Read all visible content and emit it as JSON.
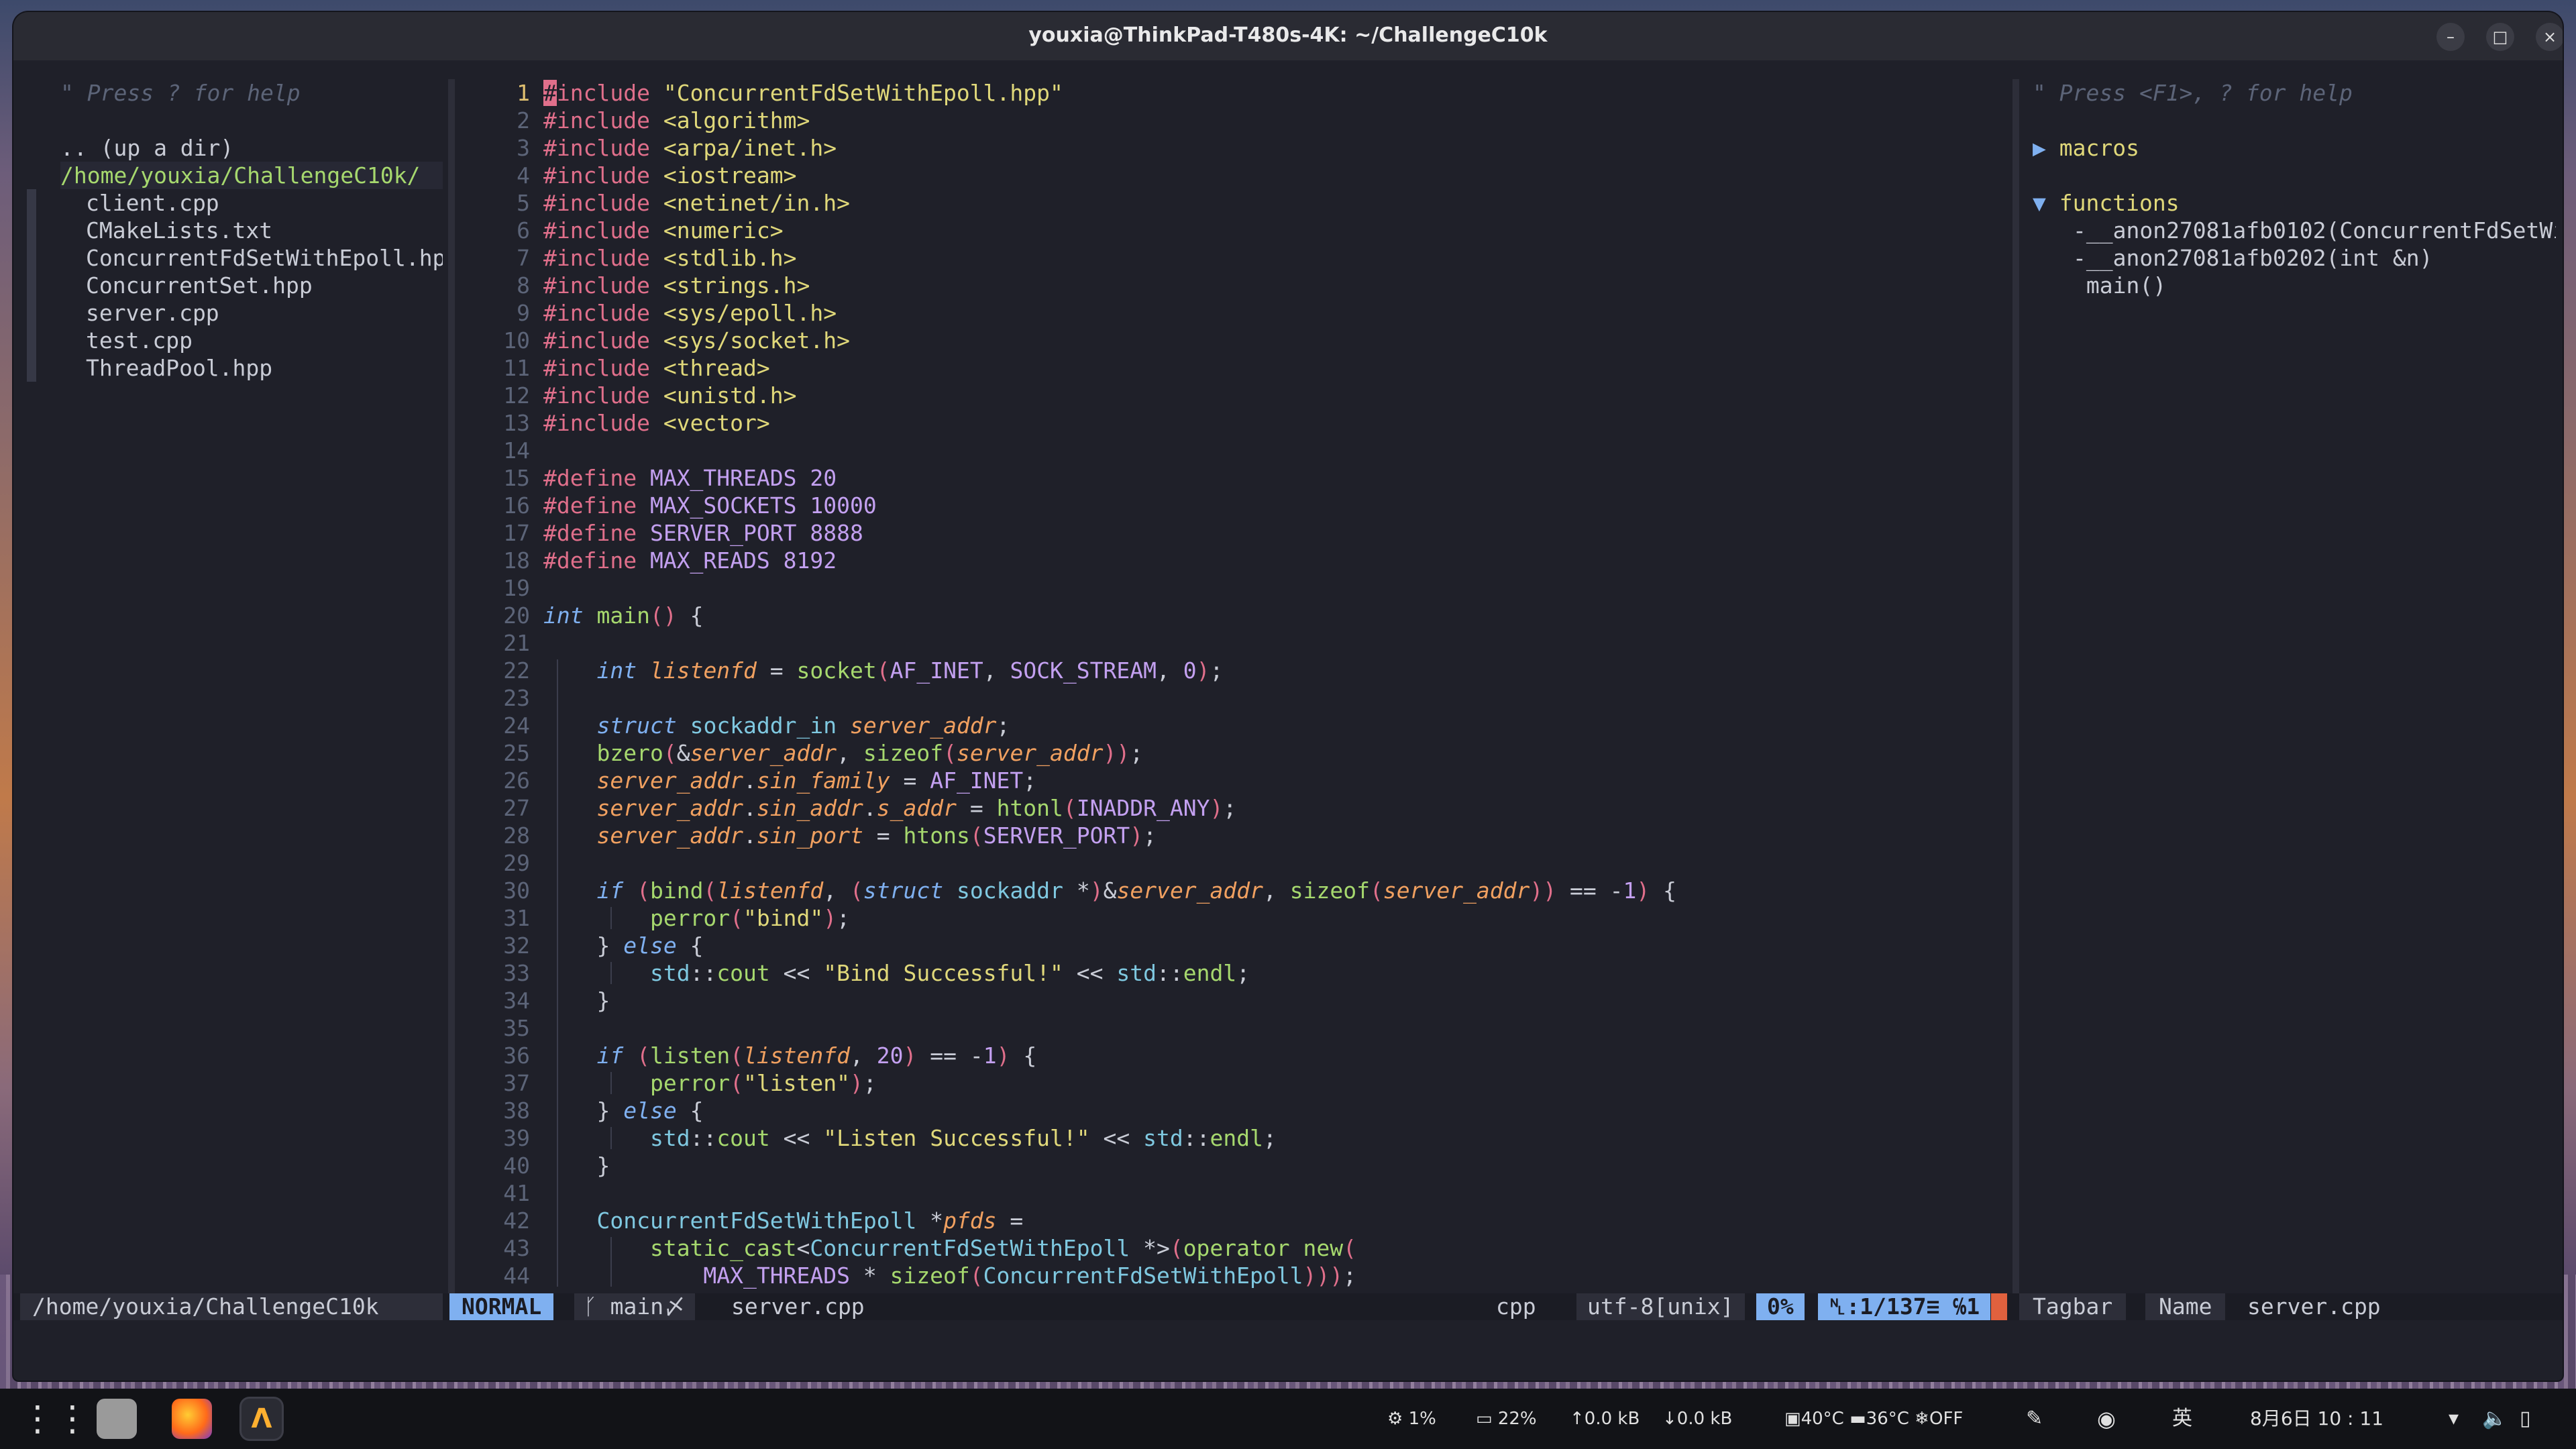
{
  "window": {
    "title": "youxia@ThinkPad-T480s-4K: ~/ChallengeC10k",
    "minimize": "–",
    "maximize": "□",
    "close": "×"
  },
  "tree": {
    "help": "\" Press ? for help",
    "updir": ".. (up a dir)",
    "cwd": "/home/youxia/ChallengeC10k/",
    "files": [
      "client.cpp",
      "CMakeLists.txt",
      "ConcurrentFdSetWithEpoll.hp",
      "ConcurrentSet.hpp",
      "server.cpp",
      "test.cpp",
      "ThreadPool.hpp"
    ]
  },
  "tagbar": {
    "help": "\" Press <F1>, ? for help",
    "macros_label": "macros",
    "functions_label": "functions",
    "functions": [
      "-__anon27081afb0102(ConcurrentFdSetWi",
      "-__anon27081afb0202(int &n)",
      " main()"
    ],
    "expanded_icon": "▼",
    "collapsed_icon": "▶"
  },
  "status": {
    "left_path": "/home/youxia/ChallengeC10k",
    "mode": "NORMAL",
    "branch": "ᚴ main〆",
    "filename": "server.cpp",
    "filetype": "cpp",
    "encoding": "utf-8[unix]",
    "percent": "0%",
    "position": "␤:1/137≡ ℅1",
    "tagbar": "Tagbar",
    "name_label": "Name",
    "tag_file": "server.cpp"
  },
  "code": {
    "line_numbers": [
      "1",
      "2",
      "3",
      "4",
      "5",
      "6",
      "7",
      "8",
      "9",
      "10",
      "11",
      "12",
      "13",
      "14",
      "15",
      "16",
      "17",
      "18",
      "19",
      "20",
      "21",
      "22",
      "23",
      "24",
      "25",
      "26",
      "27",
      "28",
      "29",
      "30",
      "31",
      "32",
      "33",
      "34",
      "35",
      "36",
      "37",
      "38",
      "39",
      "40",
      "41",
      "42",
      "43",
      "44"
    ],
    "lines": [
      "#include \"ConcurrentFdSetWithEpoll.hpp\"",
      "#include <algorithm>",
      "#include <arpa/inet.h>",
      "#include <iostream>",
      "#include <netinet/in.h>",
      "#include <numeric>",
      "#include <stdlib.h>",
      "#include <strings.h>",
      "#include <sys/epoll.h>",
      "#include <sys/socket.h>",
      "#include <thread>",
      "#include <unistd.h>",
      "#include <vector>",
      "",
      "#define MAX_THREADS 20",
      "#define MAX_SOCKETS 10000",
      "#define SERVER_PORT 8888",
      "#define MAX_READS 8192",
      "",
      "int main() {",
      "",
      "    int listenfd = socket(AF_INET, SOCK_STREAM, 0);",
      "",
      "    struct sockaddr_in server_addr;",
      "    bzero(&server_addr, sizeof(server_addr));",
      "    server_addr.sin_family = AF_INET;",
      "    server_addr.sin_addr.s_addr = htonl(INADDR_ANY);",
      "    server_addr.sin_port = htons(SERVER_PORT);",
      "",
      "    if (bind(listenfd, (struct sockaddr *)&server_addr, sizeof(server_addr)) == -1) {",
      "        perror(\"bind\");",
      "    } else {",
      "        std::cout << \"Bind Successful!\" << std::endl;",
      "    }",
      "",
      "    if (listen(listenfd, 20) == -1) {",
      "        perror(\"listen\");",
      "    } else {",
      "        std::cout << \"Listen Successful!\" << std::endl;",
      "    }",
      "",
      "    ConcurrentFdSetWithEpoll *pfds =",
      "        static_cast<ConcurrentFdSetWithEpoll *>(operator new(",
      "            MAX_THREADS * sizeof(ConcurrentFdSetWithEpoll)));"
    ]
  },
  "taskbar": {
    "apps_icon": "apps-grid-icon",
    "cpu": "1%",
    "mem": "22%",
    "up": "0.0 kB",
    "down": "0.0 kB",
    "temp1": "40°C",
    "temp2": "36°C",
    "fan": "OFF",
    "ime": "英",
    "clock": "8月6日 10 : 11"
  },
  "colors": {
    "accent": "#7fb0f0",
    "cwd": "#a6d86e",
    "preproc": "#e06f8b",
    "string": "#e0d87a"
  }
}
